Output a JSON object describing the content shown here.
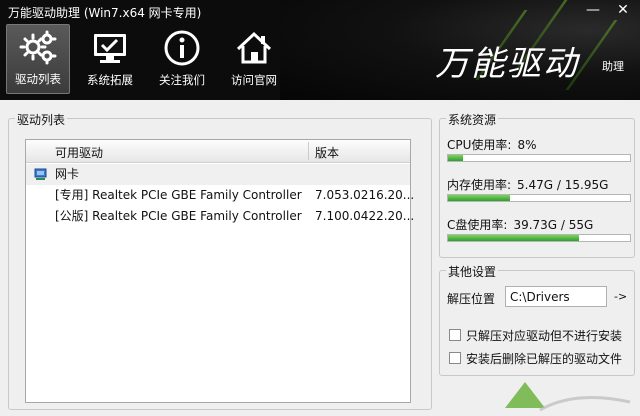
{
  "window": {
    "title": "万能驱动助理 (Win7.x64 网卡专用)",
    "minimize": "—",
    "close": "✕",
    "brand": "万能驱动",
    "brand_sub": "助理"
  },
  "toolbar": {
    "items": [
      {
        "label": "驱动列表",
        "icon": "gears-icon",
        "active": true
      },
      {
        "label": "系统拓展",
        "icon": "monitor-check-icon",
        "active": false
      },
      {
        "label": "关注我们",
        "icon": "info-icon",
        "active": false
      },
      {
        "label": "访问官网",
        "icon": "home-icon",
        "active": false
      }
    ]
  },
  "driver_list": {
    "group_label": "驱动列表",
    "columns": [
      "可用驱动",
      "版本"
    ],
    "category": "网卡",
    "rows": [
      {
        "name": "[专用] Realtek PCIe GBE Family Controller",
        "version": "7.053.0216.20..."
      },
      {
        "name": "[公版] Realtek PCIe GBE Family Controller",
        "version": "7.100.0422.20..."
      }
    ]
  },
  "resources": {
    "group_label": "系统资源",
    "cpu": {
      "label": "CPU使用率:",
      "value": "8%",
      "fraction": 0.08
    },
    "memory": {
      "label": "内存使用率:",
      "value": "5.47G / 15.95G",
      "fraction": 0.343
    },
    "disk": {
      "label": "C盘使用率:",
      "value": "39.73G / 55G",
      "fraction": 0.72
    }
  },
  "settings": {
    "group_label": "其他设置",
    "path_label": "解压位置",
    "path_value": "C:\\Drivers",
    "path_button": "->",
    "option1": "只解压对应驱动但不进行安装",
    "option2": "安装后删除已解压的驱动文件"
  },
  "colors": {
    "header_bg": "#0c0c0c",
    "accent_green": "#2f9e2f",
    "panel_bg": "#efefef"
  }
}
